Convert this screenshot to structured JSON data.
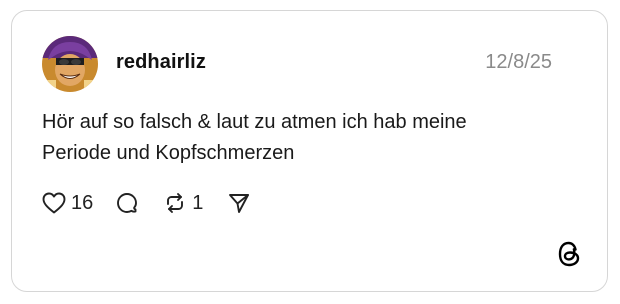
{
  "post": {
    "username": "redhairliz",
    "date": "12/8/25",
    "text_line1": "Hör auf so falsch & laut zu atmen ich hab meine",
    "text_line2": "Periode und Kopfschmerzen",
    "likes": "16",
    "reposts": "1"
  },
  "icons": {
    "like": "heart-icon",
    "comment": "comment-bubble-icon",
    "repost": "repost-icon",
    "share": "send-icon",
    "brand": "threads-logo-icon"
  },
  "colors": {
    "text": "#1a1a1a",
    "muted": "#8a8a8a",
    "border": "#d6d6d6"
  }
}
